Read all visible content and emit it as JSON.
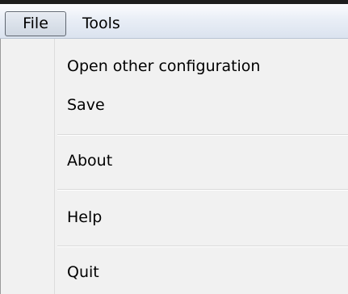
{
  "menubar": {
    "items": [
      {
        "label": "File",
        "open": true
      },
      {
        "label": "Tools",
        "open": false
      }
    ]
  },
  "file_menu": {
    "items": [
      {
        "label": "Open other configuration"
      },
      {
        "label": "Save"
      },
      {
        "label": "About"
      },
      {
        "label": "Help"
      },
      {
        "label": "Quit"
      }
    ]
  },
  "colors": {
    "menubar_top": "#fbfcfe",
    "menubar_bottom": "#dbe3ef",
    "menu_background": "#f1f1f1",
    "separator": "#dadada",
    "backdrop": "#1e1e1e"
  }
}
